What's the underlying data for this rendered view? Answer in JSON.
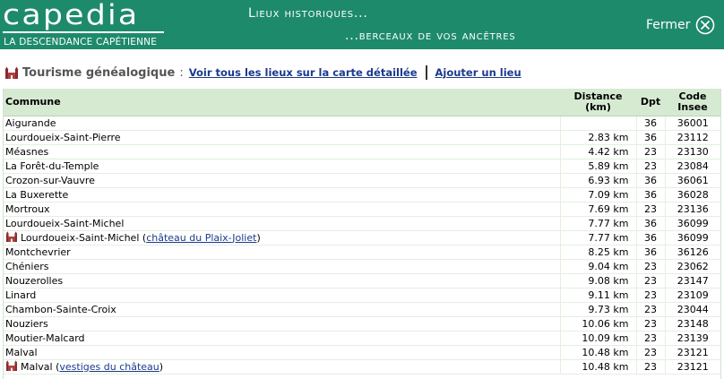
{
  "header": {
    "logo": "capedia",
    "tagline": "LA DESCENDANCE CAPÉTIENNE",
    "title_line1": "Lieux historiques...",
    "title_line2": "...berceaux de vos ancêtres",
    "close_label": "Fermer",
    "background_color": "#1e8a6c"
  },
  "toolbar": {
    "icon": "castle-icon",
    "section_title": "Tourisme généalogique",
    "colon": ":",
    "link_map": "Voir tous les lieux sur la carte détaillée",
    "link_add": "Ajouter un lieu",
    "link_color": "#1a3a8c"
  },
  "table": {
    "header_bg": "#d6ead2",
    "columns": {
      "commune": "Commune",
      "distance": "Distance (km)",
      "dpt": "Dpt",
      "code": "Code Insee"
    },
    "rows": [
      {
        "commune": "Aigurande",
        "site": "",
        "distance": "",
        "dpt": "36",
        "code": "36001"
      },
      {
        "commune": "Lourdoueix-Saint-Pierre",
        "site": "",
        "distance": "2.83 km",
        "dpt": "36",
        "code": "23112"
      },
      {
        "commune": "Méasnes",
        "site": "",
        "distance": "4.42 km",
        "dpt": "23",
        "code": "23130"
      },
      {
        "commune": "La Forêt-du-Temple",
        "site": "",
        "distance": "5.89 km",
        "dpt": "23",
        "code": "23084"
      },
      {
        "commune": "Crozon-sur-Vauvre",
        "site": "",
        "distance": "6.93 km",
        "dpt": "36",
        "code": "36061"
      },
      {
        "commune": "La Buxerette",
        "site": "",
        "distance": "7.09 km",
        "dpt": "36",
        "code": "36028"
      },
      {
        "commune": "Mortroux",
        "site": "",
        "distance": "7.69 km",
        "dpt": "23",
        "code": "23136"
      },
      {
        "commune": "Lourdoueix-Saint-Michel",
        "site": "",
        "distance": "7.77 km",
        "dpt": "36",
        "code": "36099"
      },
      {
        "commune": "Lourdoueix-Saint-Michel",
        "site": "château du Plaix-Joliet",
        "distance": "7.77 km",
        "dpt": "36",
        "code": "36099"
      },
      {
        "commune": "Montchevrier",
        "site": "",
        "distance": "8.25 km",
        "dpt": "36",
        "code": "36126"
      },
      {
        "commune": "Chéniers",
        "site": "",
        "distance": "9.04 km",
        "dpt": "23",
        "code": "23062"
      },
      {
        "commune": "Nouzerolles",
        "site": "",
        "distance": "9.08 km",
        "dpt": "23",
        "code": "23147"
      },
      {
        "commune": "Linard",
        "site": "",
        "distance": "9.11 km",
        "dpt": "23",
        "code": "23109"
      },
      {
        "commune": "Chambon-Sainte-Croix",
        "site": "",
        "distance": "9.73 km",
        "dpt": "23",
        "code": "23044"
      },
      {
        "commune": "Nouziers",
        "site": "",
        "distance": "10.06 km",
        "dpt": "23",
        "code": "23148"
      },
      {
        "commune": "Moutier-Malcard",
        "site": "",
        "distance": "10.09 km",
        "dpt": "23",
        "code": "23139"
      },
      {
        "commune": "Malval",
        "site": "",
        "distance": "10.48 km",
        "dpt": "23",
        "code": "23121"
      },
      {
        "commune": "Malval",
        "site": "vestiges du château",
        "distance": "10.48 km",
        "dpt": "23",
        "code": "23121"
      }
    ]
  }
}
